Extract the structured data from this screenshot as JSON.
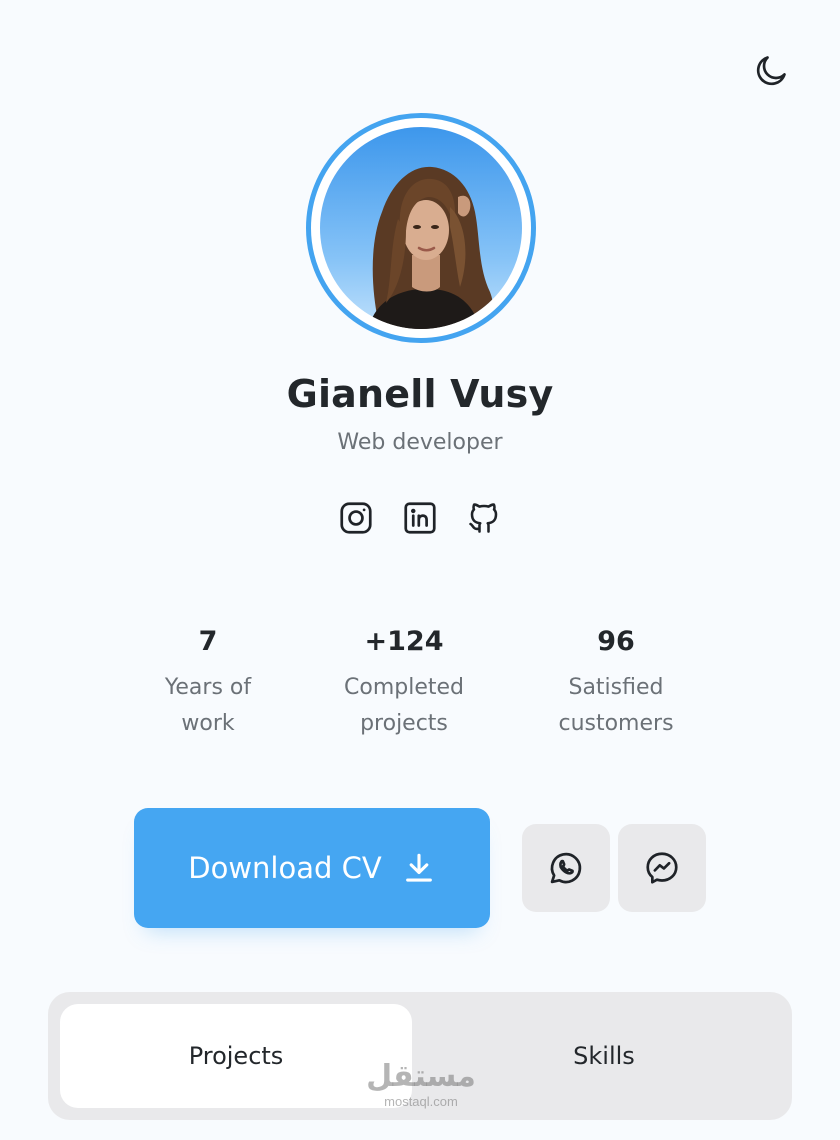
{
  "header": {
    "theme_toggle_icon": "moon-icon"
  },
  "profile": {
    "name": "Gianell Vusy",
    "role": "Web developer",
    "avatar_ring_color": "#44a4f0"
  },
  "socials": [
    {
      "icon": "instagram-icon"
    },
    {
      "icon": "linkedin-icon"
    },
    {
      "icon": "github-icon"
    }
  ],
  "stats": [
    {
      "value": "7",
      "label_line1": "Years of",
      "label_line2": "work"
    },
    {
      "value": "+124",
      "label_line1": "Completed",
      "label_line2": "projects"
    },
    {
      "value": "96",
      "label_line1": "Satisfied",
      "label_line2": "customers"
    }
  ],
  "actions": {
    "download_label": "Download CV",
    "download_icon": "download-icon",
    "accent_color": "#45a6f2",
    "contacts": [
      {
        "icon": "whatsapp-icon"
      },
      {
        "icon": "messenger-icon"
      }
    ]
  },
  "tabs": {
    "items": [
      {
        "label": "Projects",
        "active": true
      },
      {
        "label": "Skills",
        "active": false
      }
    ]
  },
  "watermark": {
    "arabic": "مستقل",
    "latin": "mostaql.com"
  }
}
